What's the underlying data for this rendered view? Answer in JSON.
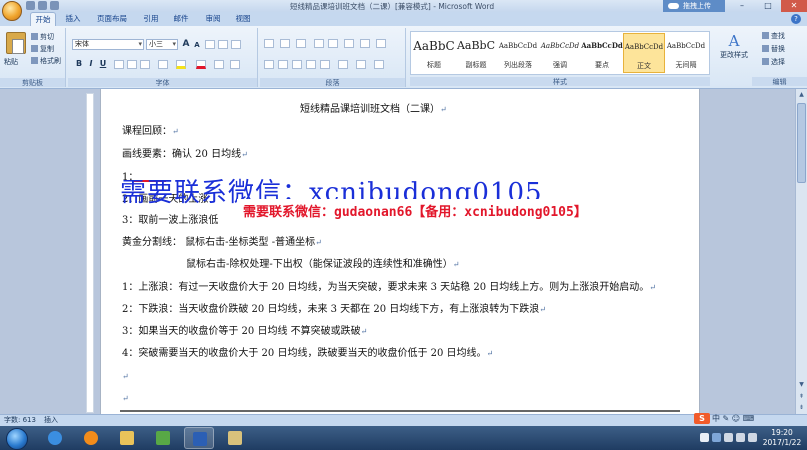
{
  "window": {
    "title": "短线精品课培训班文档（二课）[兼容模式] - Microsoft Word",
    "cloud_label": "拖拽上传",
    "min": "–",
    "max": "□",
    "close": "✕"
  },
  "tabs": [
    "开始",
    "插入",
    "页面布局",
    "引用",
    "邮件",
    "审阅",
    "视图"
  ],
  "ribbon": {
    "clipboard": {
      "paste": "粘贴",
      "cut": "剪切",
      "copy": "复制",
      "format_painter": "格式刷",
      "label": "剪贴板"
    },
    "font": {
      "name": "宋体",
      "size": "小三",
      "grow": "A",
      "shrink": "A",
      "bold": "B",
      "italic": "I",
      "underline": "U",
      "label": "字体"
    },
    "paragraph": {
      "label": "段落"
    },
    "styles": {
      "label": "样式",
      "items": [
        {
          "preview": "AaBbC",
          "name": "标题"
        },
        {
          "preview": "AaBbC",
          "name": "副标题"
        },
        {
          "preview": "AaBbCcDd",
          "name": "列出段落"
        },
        {
          "preview": "AaBbCcDd",
          "name": "强调"
        },
        {
          "preview": "AaBbCcDd",
          "name": "要点"
        },
        {
          "preview": "AaBbCcDd",
          "name": "正文"
        },
        {
          "preview": "AaBbCcDd",
          "name": "无间隔"
        }
      ],
      "change_styles": "更改样式"
    },
    "editing": {
      "find": "查找",
      "replace": "替换",
      "select": "选择",
      "label": "编辑"
    }
  },
  "document": {
    "title": "短线精品课培训班文档（二课）",
    "lines": [
      "课程回顾：",
      "画线要素：确认 20 日均线",
      "1：",
      "2：画前一天的上涨",
      "3：取前一波上涨浪低",
      "黄金分割线： 鼠标右击-坐标类型 -普通坐标",
      "鼠标右击-除权处理-下出权（能保证波段的连续性和准确性）",
      "1：上涨浪：有过一天收盘价大于 20 日均线，为当天突破，要求未来 3 天站稳 20 日均线上方。则为上涨浪开始启动。",
      "2：下跌浪：当天收盘价跌破 20 日均线，未来 3 天都在 20 日均线下方，有上涨浪转为下跌浪",
      "3：如果当天的收盘价等于 20 日均线 不算突破或跌破",
      "4：突破需要当天的收盘价大于 20 日均线，跌破要当天的收盘价低于 20 日均线。"
    ],
    "para_mark": "↵"
  },
  "watermarks": {
    "blue": "需要联系微信：xcnibudong0105",
    "red": "需要联系微信：gudaonan66【备用：xcnibudong0105】"
  },
  "status": {
    "word_count": "字数: 613",
    "mode": "插入"
  },
  "ime": {
    "logo": "S",
    "text": "中 ✎ ☺ ⌨"
  },
  "clock": {
    "time": "19:20",
    "date": "2017/1/22"
  }
}
